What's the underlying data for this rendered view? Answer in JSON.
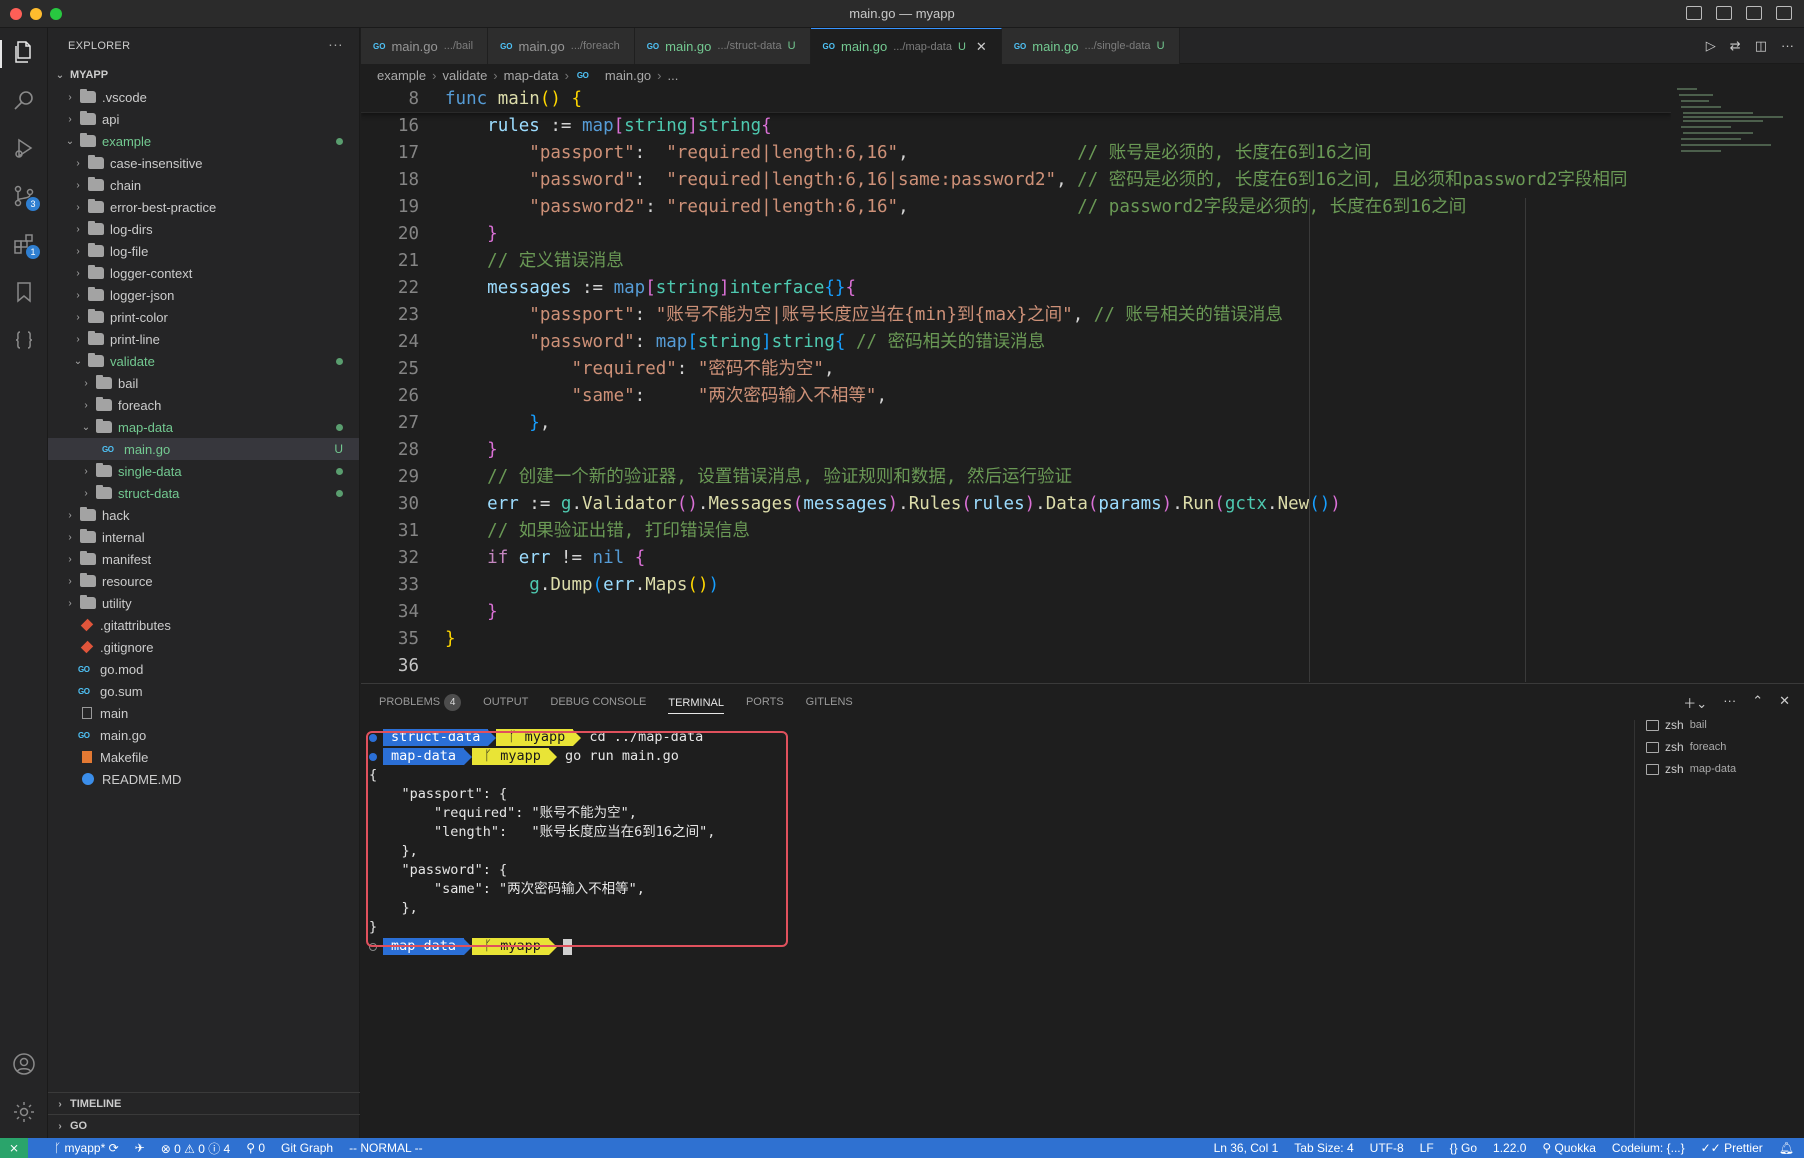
{
  "window": {
    "title": "main.go — myapp"
  },
  "activity_bar": {
    "items": [
      {
        "name": "explorer",
        "badge": ""
      },
      {
        "name": "search",
        "badge": ""
      },
      {
        "name": "run-debug",
        "badge": ""
      },
      {
        "name": "source-control",
        "badge": "3"
      },
      {
        "name": "extensions",
        "badge": "1"
      },
      {
        "name": "bookmarks",
        "badge": ""
      },
      {
        "name": "json",
        "badge": ""
      }
    ]
  },
  "sidebar": {
    "header": "EXPLORER",
    "more": "···",
    "project": "MYAPP",
    "tree": [
      {
        "label": ".vscode",
        "depth": 1,
        "type": "folder"
      },
      {
        "label": "api",
        "depth": 1,
        "type": "folder"
      },
      {
        "label": "example",
        "depth": 1,
        "type": "folder-open",
        "mod": true
      },
      {
        "label": "case-insensitive",
        "depth": 2,
        "type": "folder"
      },
      {
        "label": "chain",
        "depth": 2,
        "type": "folder"
      },
      {
        "label": "error-best-practice",
        "depth": 2,
        "type": "folder"
      },
      {
        "label": "log-dirs",
        "depth": 2,
        "type": "folder"
      },
      {
        "label": "log-file",
        "depth": 2,
        "type": "folder"
      },
      {
        "label": "logger-context",
        "depth": 2,
        "type": "folder"
      },
      {
        "label": "logger-json",
        "depth": 2,
        "type": "folder"
      },
      {
        "label": "print-color",
        "depth": 2,
        "type": "folder"
      },
      {
        "label": "print-line",
        "depth": 2,
        "type": "folder"
      },
      {
        "label": "validate",
        "depth": 2,
        "type": "folder-open",
        "mod": true
      },
      {
        "label": "bail",
        "depth": 3,
        "type": "folder"
      },
      {
        "label": "foreach",
        "depth": 3,
        "type": "folder"
      },
      {
        "label": "map-data",
        "depth": 3,
        "type": "folder-open",
        "mod": true
      },
      {
        "label": "main.go",
        "depth": 4,
        "type": "go",
        "mod": true,
        "selected": true,
        "status": "U"
      },
      {
        "label": "single-data",
        "depth": 3,
        "type": "folder",
        "mod": true
      },
      {
        "label": "struct-data",
        "depth": 3,
        "type": "folder",
        "mod": true
      },
      {
        "label": "hack",
        "depth": 1,
        "type": "folder"
      },
      {
        "label": "internal",
        "depth": 1,
        "type": "folder"
      },
      {
        "label": "manifest",
        "depth": 1,
        "type": "folder"
      },
      {
        "label": "resource",
        "depth": 1,
        "type": "folder"
      },
      {
        "label": "utility",
        "depth": 1,
        "type": "folder"
      },
      {
        "label": ".gitattributes",
        "depth": 1,
        "type": "git"
      },
      {
        "label": ".gitignore",
        "depth": 1,
        "type": "git"
      },
      {
        "label": "go.mod",
        "depth": 1,
        "type": "go"
      },
      {
        "label": "go.sum",
        "depth": 1,
        "type": "go"
      },
      {
        "label": "main",
        "depth": 1,
        "type": "file"
      },
      {
        "label": "main.go",
        "depth": 1,
        "type": "go"
      },
      {
        "label": "Makefile",
        "depth": 1,
        "type": "make"
      },
      {
        "label": "README.MD",
        "depth": 1,
        "type": "info"
      }
    ],
    "timeline": "TIMELINE",
    "go_section": "GO"
  },
  "tabs": [
    {
      "name": "main.go",
      "path": ".../bail",
      "active": false,
      "mod": false,
      "status": ""
    },
    {
      "name": "main.go",
      "path": ".../foreach",
      "active": false,
      "mod": false,
      "status": ""
    },
    {
      "name": "main.go",
      "path": ".../struct-data",
      "active": false,
      "mod": true,
      "status": "U"
    },
    {
      "name": "main.go",
      "path": ".../map-data",
      "active": true,
      "mod": true,
      "status": "U"
    },
    {
      "name": "main.go",
      "path": ".../single-data",
      "active": false,
      "mod": true,
      "status": "U"
    }
  ],
  "breadcrumb": [
    "example",
    "validate",
    "map-data",
    "main.go",
    "..."
  ],
  "code": {
    "sticky": {
      "n": "8",
      "text": "func main() {"
    },
    "lines": [
      {
        "n": "16"
      },
      {
        "n": "17"
      },
      {
        "n": "18"
      },
      {
        "n": "19"
      },
      {
        "n": "20"
      },
      {
        "n": "21"
      },
      {
        "n": "22"
      },
      {
        "n": "23"
      },
      {
        "n": "24"
      },
      {
        "n": "25"
      },
      {
        "n": "26"
      },
      {
        "n": "27"
      },
      {
        "n": "28"
      },
      {
        "n": "29"
      },
      {
        "n": "30"
      },
      {
        "n": "31"
      },
      {
        "n": "32"
      },
      {
        "n": "33"
      },
      {
        "n": "34"
      },
      {
        "n": "35"
      },
      {
        "n": "36"
      }
    ],
    "tokens": {
      "rules": "rules",
      "assign": " := ",
      "map": "map",
      "string": "string",
      "interface": "interface",
      "passport_key": "\"passport\"",
      "password_key": "\"password\"",
      "password2_key": "\"password2\"",
      "rule17": "\"required|length:6,16\"",
      "rule18": "\"required|length:6,16|same:password2\"",
      "rule19": "\"required|length:6,16\"",
      "c17": "// 账号是必须的, 长度在6到16之间",
      "c18": "// 密码是必须的, 长度在6到16之间, 且必须和password2字段相同",
      "c19": "// password2字段是必须的, 长度在6到16之间",
      "c21": "// 定义错误消息",
      "messages": "messages",
      "msg23": "\"账号不能为空|账号长度应当在{min}到{max}之间\"",
      "c23": "// 账号相关的错误消息",
      "c24": "// 密码相关的错误消息",
      "required_key": "\"required\"",
      "same_key": "\"same\"",
      "msg25": "\"密码不能为空\"",
      "msg26": "\"两次密码输入不相等\"",
      "c29": "// 创建一个新的验证器, 设置错误消息, 验证规则和数据, 然后运行验证",
      "err": "err",
      "g": "g",
      "Validator": "Validator",
      "Messages": "Messages",
      "Rules": "Rules",
      "Data": "Data",
      "params": "params",
      "Run": "Run",
      "gctx": "gctx",
      "New": "New",
      "c31": "// 如果验证出错, 打印错误信息",
      "if": "if",
      "neq": " != ",
      "nil": "nil",
      "Dump": "Dump",
      "Maps": "Maps"
    }
  },
  "panel": {
    "tabs": [
      "PROBLEMS",
      "OUTPUT",
      "DEBUG CONSOLE",
      "TERMINAL",
      "PORTS",
      "GITLENS"
    ],
    "problems_count": "4",
    "active_tab": "TERMINAL",
    "terminal": {
      "prompt1_dir": "struct-data",
      "prompt1_branch": "myapp",
      "cmd1": " cd ../map-data",
      "prompt2_dir": "map-data",
      "prompt2_branch": "myapp",
      "cmd2": " go run main.go",
      "output": [
        "{",
        "    \"passport\": {",
        "        \"required\": \"账号不能为空\",",
        "        \"length\":   \"账号长度应当在6到16之间\",",
        "    },",
        "    \"password\": {",
        "        \"same\": \"两次密码输入不相等\",",
        "    },",
        "}"
      ],
      "prompt3_dir": "map-data",
      "prompt3_branch": "myapp"
    },
    "terminals": [
      {
        "shell": "zsh",
        "name": "bail"
      },
      {
        "shell": "zsh",
        "name": "foreach"
      },
      {
        "shell": "zsh",
        "name": "map-data"
      }
    ]
  },
  "status_bar": {
    "branch": "myapp*",
    "problems": "0 ⚠ 0 ⓘ 4",
    "ports": "0",
    "git_graph": "Git Graph",
    "mode": "-- NORMAL --",
    "position": "Ln 36, Col 1",
    "tab_size": "Tab Size: 4",
    "encoding": "UTF-8",
    "eol": "LF",
    "language": "Go",
    "go_version": "1.22.0",
    "quokka": "Quokka",
    "codeium": "Codeium: {...}",
    "prettier": "Prettier"
  },
  "colors": {
    "accent": "#3794ff",
    "status_bar": "#2f71d1",
    "modified": "#73c991",
    "highlight_box": "#e0515d"
  }
}
